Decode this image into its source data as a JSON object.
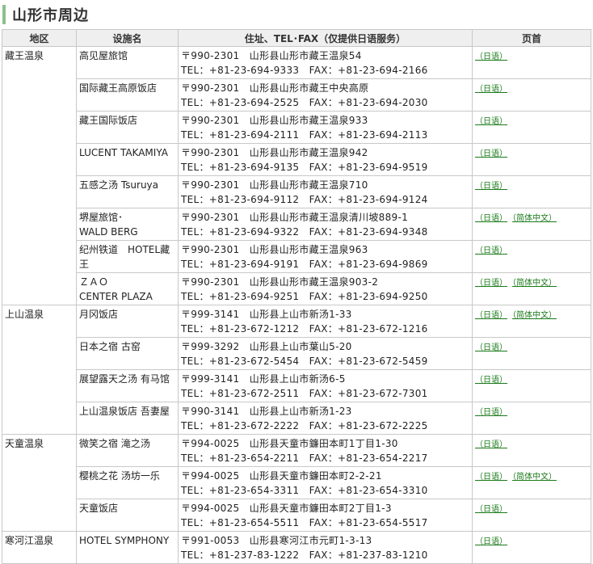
{
  "page_title": "山形市周边",
  "headers": [
    "地区",
    "设施名",
    "住址、TEL･FAX（仅提供日语服务）",
    "页首"
  ],
  "groups": [
    {
      "area": "藏王温泉",
      "rows": [
        {
          "name": [
            "高见屋旅馆"
          ],
          "addr": "〒990-2301　山形县山形市藏王温泉54",
          "tel": "TEL：+81-23-694-9333　FAX：+81-23-694-2166",
          "links": [
            "（日语）"
          ]
        },
        {
          "name": [
            "国际藏王高原饭店"
          ],
          "addr": "〒990-2301　山形县山形市藏王中央高原",
          "tel": "TEL：+81-23-694-2525　FAX：+81-23-694-2030",
          "links": [
            "（日语）"
          ]
        },
        {
          "name": [
            "藏王国际饭店"
          ],
          "addr": "〒990-2301　山形县山形市藏王温泉933",
          "tel": "TEL：+81-23-694-2111　FAX：+81-23-694-2113",
          "links": [
            "（日语）"
          ]
        },
        {
          "name": [
            "LUCENT TAKAMIYA"
          ],
          "addr": "〒990-2301　山形县山形市藏王温泉942",
          "tel": "TEL：+81-23-694-9135　FAX：+81-23-694-9519",
          "links": [
            "（日语）"
          ]
        },
        {
          "name": [
            "五感之汤 Tsuruya"
          ],
          "addr": "〒990-2301　山形县山形市藏王温泉710",
          "tel": "TEL：+81-23-694-9112　FAX：+81-23-694-9124",
          "links": [
            "（日语）"
          ]
        },
        {
          "name": [
            "堺屋旅馆･",
            "WALD BERG"
          ],
          "addr": "〒990-2301　山形县山形市藏王温泉清川坡889-1",
          "tel": "TEL：+81-23-694-9322　FAX：+81-23-694-9348",
          "links": [
            "（日语）",
            "（简体中文）"
          ]
        },
        {
          "name": [
            "纪州铁道　HOTEL藏",
            "王"
          ],
          "addr": "〒990-2301　山形县山形市藏王温泉963",
          "tel": "TEL：+81-23-694-9191　FAX：+81-23-694-9869",
          "links": [
            "（日语）"
          ]
        },
        {
          "name": [
            "ＺＡＯ",
            "CENTER PLAZA"
          ],
          "addr": "〒990-2301　山形县山形市藏王温泉903-2",
          "tel": "TEL：+81-23-694-9251　FAX：+81-23-694-9250",
          "links": [
            "（日语）",
            "（简体中文）"
          ]
        }
      ]
    },
    {
      "area": "上山温泉",
      "rows": [
        {
          "name": [
            "月冈饭店"
          ],
          "addr": "〒999-3141　山形县上山市新汤1-33",
          "tel": "TEL：+81-23-672-1212　FAX：+81-23-672-1216",
          "links": [
            "（日语）",
            "（简体中文）"
          ]
        },
        {
          "name": [
            "日本之宿 古窑"
          ],
          "addr": "〒999-3292　山形县上山市葉山5-20",
          "tel": "TEL：+81-23-672-5454　FAX：+81-23-672-5459",
          "links": [
            "（日语）"
          ]
        },
        {
          "name": [
            "展望露天之汤 有马馆"
          ],
          "addr": "〒999-3141　山形县上山市新汤6-5",
          "tel": "TEL：+81-23-672-2511　FAX：+81-23-672-7301",
          "links": [
            "（日语）"
          ]
        },
        {
          "name": [
            "上山温泉饭店 吾妻屋"
          ],
          "addr": "〒990-3141　山形县上山市新汤1-23",
          "tel": "TEL：+81-23-672-2222　FAX：+81-23-672-2225",
          "links": [
            "（日语）"
          ]
        }
      ]
    },
    {
      "area": "天童温泉",
      "rows": [
        {
          "name": [
            "微笑之宿 滝之汤"
          ],
          "addr": "〒994-0025　山形县天童市鐮田本町1丁目1-30",
          "tel": "TEL：+81-23-654-2211　FAX：+81-23-654-2217",
          "links": [
            "（日语）"
          ]
        },
        {
          "name": [
            "樱桃之花 汤坊一乐"
          ],
          "addr": "〒994-0025　山形县天童市鐮田本町2-2-21",
          "tel": "TEL：+81-23-654-3311　FAX：+81-23-654-3310",
          "links": [
            "（日语）",
            "（简体中文）"
          ]
        },
        {
          "name": [
            "天童饭店"
          ],
          "addr": "〒994-0025　山形县天童市鐮田本町2丁目1-3",
          "tel": "TEL：+81-23-654-5511　FAX：+81-23-654-5517",
          "links": [
            "（日语）"
          ]
        }
      ]
    },
    {
      "area": "寒河江温泉",
      "rows": [
        {
          "name": [
            "HOTEL SYMPHONY"
          ],
          "addr": "〒991-0053　山形县寒河江市元町1-3-13",
          "tel": "TEL：+81-237-83-1222　FAX：+81-237-83-1210",
          "links": [
            "（日语）"
          ]
        }
      ]
    }
  ]
}
